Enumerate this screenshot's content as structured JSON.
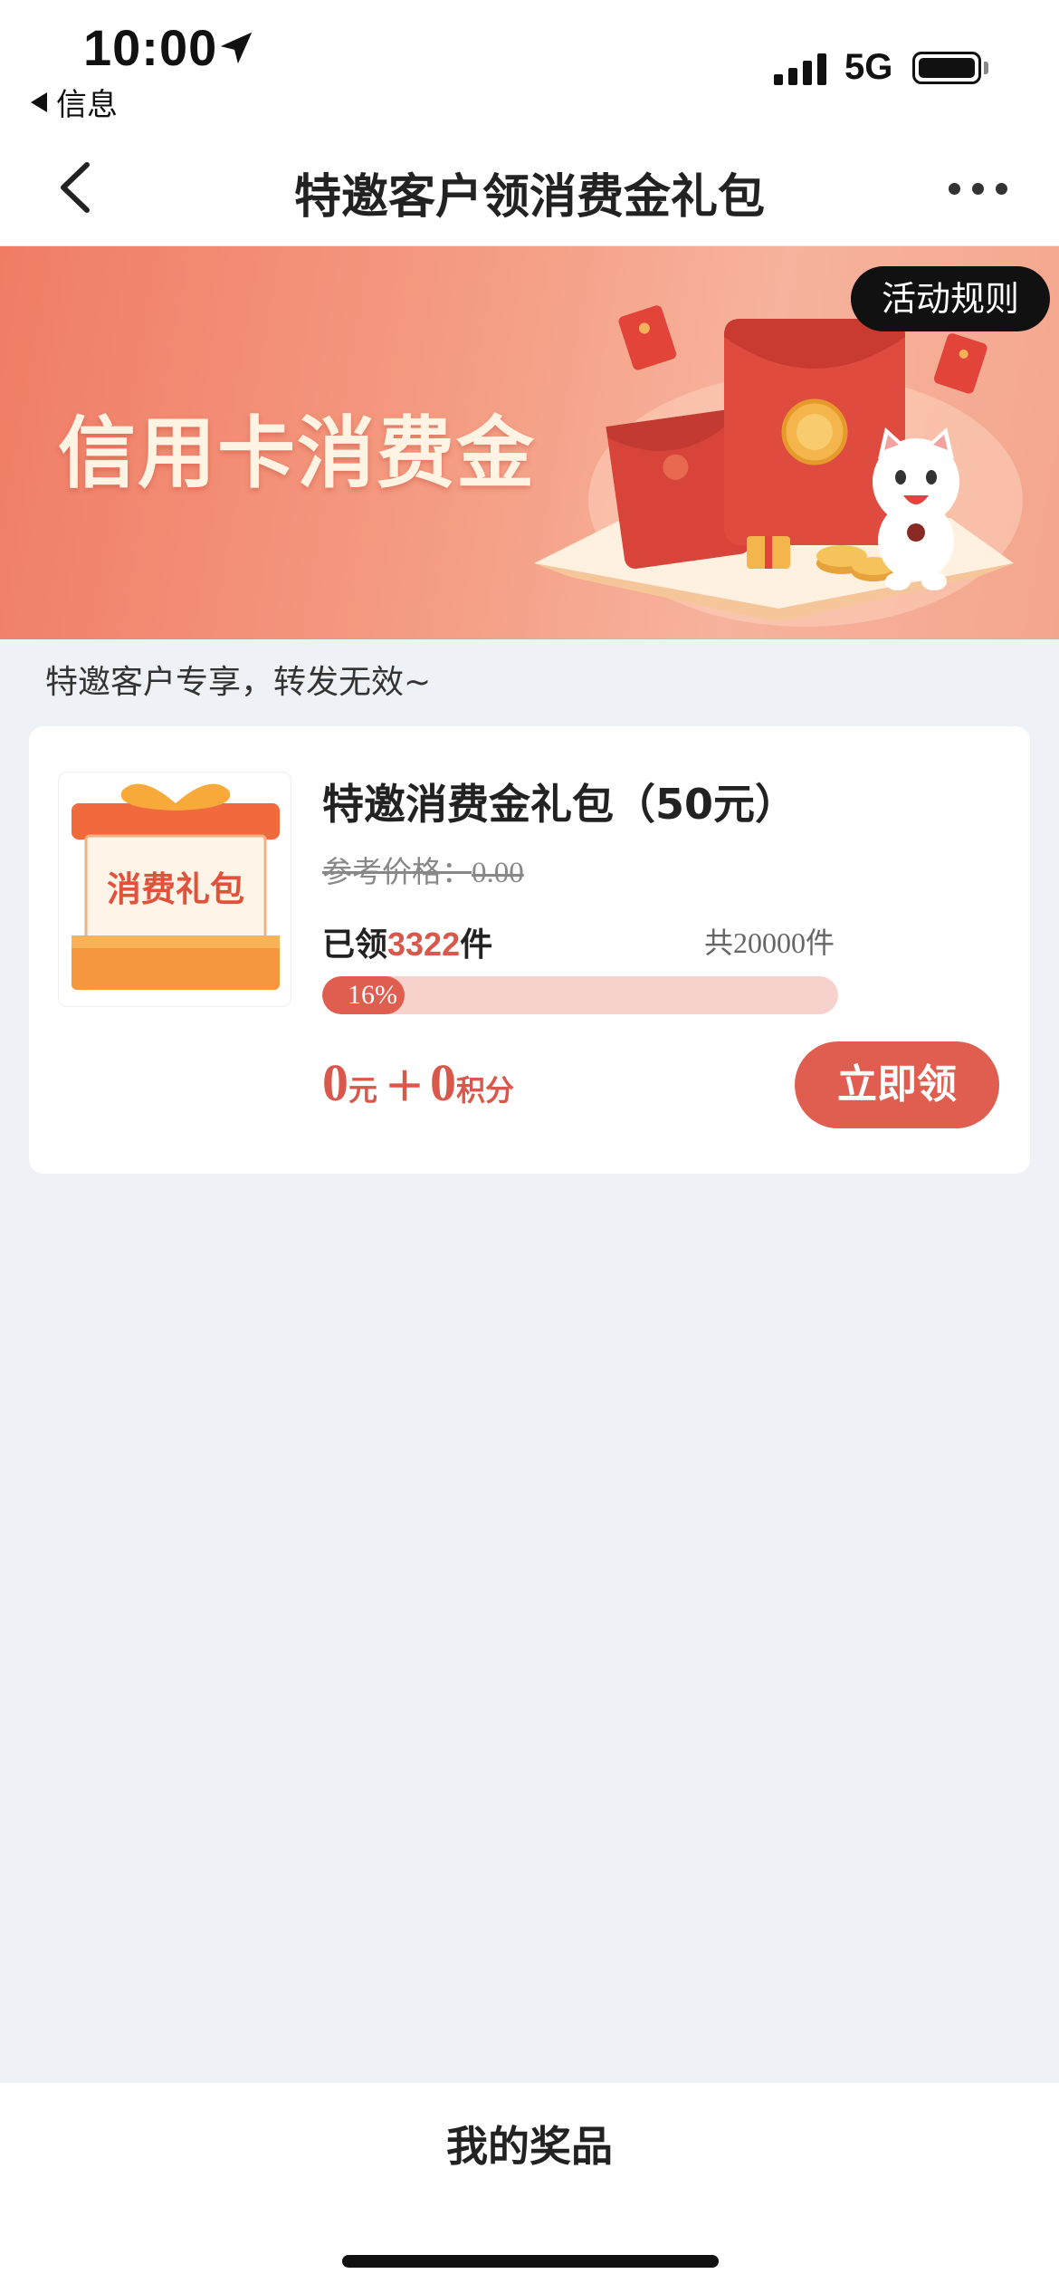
{
  "status_bar": {
    "time": "10:00",
    "back_app": "信息",
    "network": "5G"
  },
  "nav": {
    "title": "特邀客户领消费金礼包"
  },
  "banner": {
    "title": "信用卡消费金",
    "rules_label": "活动规则"
  },
  "notice": "特邀客户专享，转发无效~",
  "product": {
    "image_label": "消费礼包",
    "title": "特邀消费金礼包（50元）",
    "ref_price_label": "参考价格：",
    "ref_price_value": "0.00",
    "claimed_prefix": "已领",
    "claimed_count": "3322",
    "claimed_suffix": "件",
    "total_label": "共",
    "total_count": "20000",
    "total_suffix": "件",
    "progress_percent": 16,
    "progress_text": "16%",
    "price_amount": "0",
    "price_unit": "元",
    "plus": "＋",
    "points_amount": "0",
    "points_unit": "积分",
    "claim_label": "立即领"
  },
  "bottom": {
    "my_prizes": "我的奖品"
  },
  "colors": {
    "accent": "#e05e50",
    "progress_track": "#f7d2cd",
    "page_bg": "#eef1f6"
  }
}
